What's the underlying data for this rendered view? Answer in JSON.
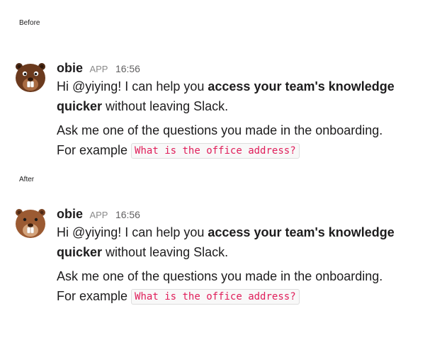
{
  "labels": {
    "before": "Before",
    "after": "After"
  },
  "messages": [
    {
      "variant": "before",
      "avatar_icon": "beaver-avatar-icon",
      "sender": "obie",
      "badge": "APP",
      "time": "16:56",
      "greeting": "Hi @yiying! I can help you ",
      "bold": "access your team's knowledge quicker",
      "tail": " without leaving Slack.",
      "line2": "Ask me one of the questions you made in the onboarding.",
      "example_prefix": "For example ",
      "example_code": "What is the office address?"
    },
    {
      "variant": "after",
      "avatar_icon": "beaver-avatar-icon",
      "sender": "obie",
      "badge": "APP",
      "time": "16:56",
      "greeting": "Hi @yiying! I can help you ",
      "bold": "access your team's knowledge quicker",
      "tail": " without leaving Slack.",
      "line2": "Ask me one of the questions you made in the onboarding.",
      "example_prefix": "For example ",
      "example_code": "What is the office address?"
    }
  ],
  "colors": {
    "code_text": "#e01e5a",
    "code_bg": "#f8f8f8",
    "beaver_before_fur": "#6b3a1e",
    "beaver_after_fur": "#9b5a32"
  }
}
